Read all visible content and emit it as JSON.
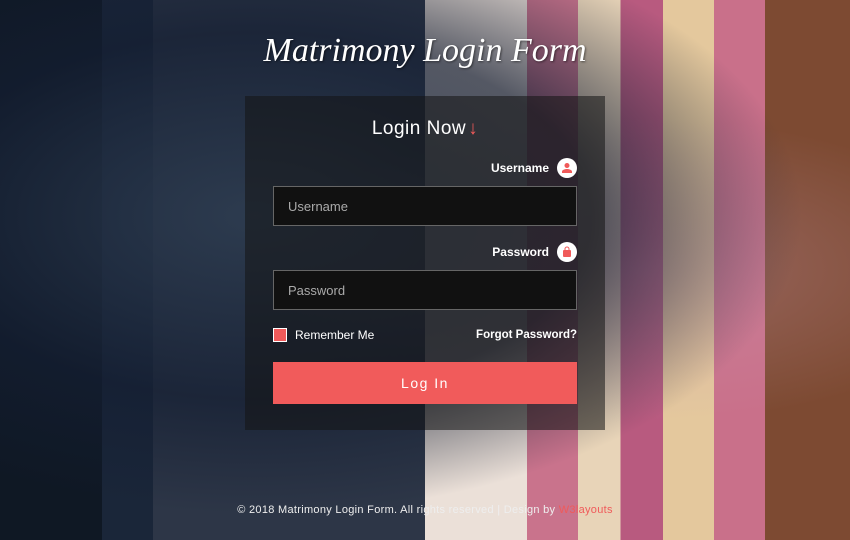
{
  "page": {
    "title": "Matrimony Login Form"
  },
  "panel": {
    "heading": "Login Now",
    "arrow": "↓"
  },
  "fields": {
    "username": {
      "label": "Username",
      "placeholder": "Username",
      "value": ""
    },
    "password": {
      "label": "Password",
      "placeholder": "Password",
      "value": ""
    }
  },
  "options": {
    "remember_label": "Remember Me",
    "forgot_label": "Forgot Password?"
  },
  "actions": {
    "login_label": "Log In"
  },
  "footer": {
    "text": "© 2018 Matrimony Login Form. All rights reserved | Design by ",
    "link_text": "W3layouts"
  },
  "colors": {
    "accent": "#f05a5a"
  }
}
